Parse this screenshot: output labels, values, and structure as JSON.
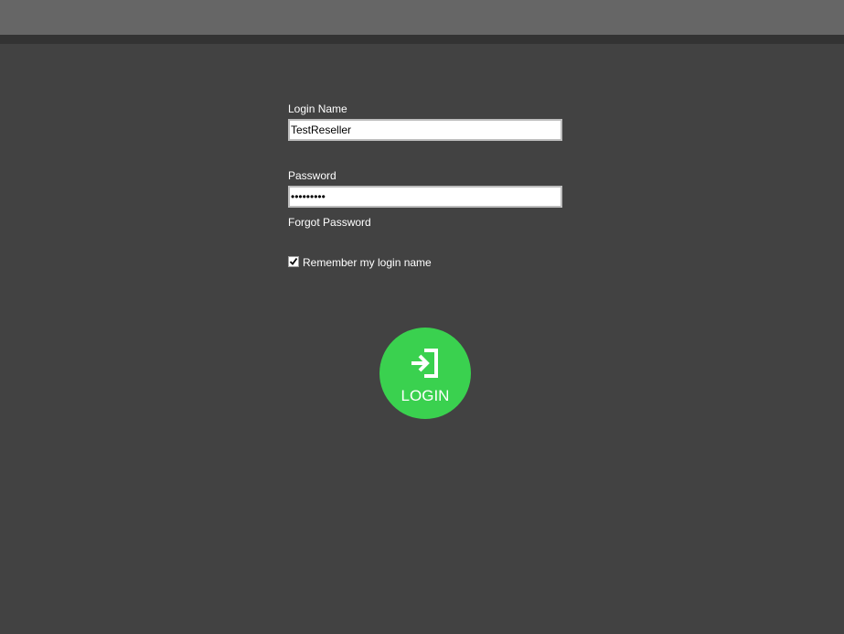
{
  "form": {
    "login_name_label": "Login Name",
    "login_name_value": "TestReseller",
    "password_label": "Password",
    "password_value": "•••••••••",
    "forgot_password": "Forgot Password",
    "remember_label": "Remember my login name",
    "remember_checked": true
  },
  "login_button": {
    "label": "LOGIN",
    "icon": "sign-in-icon",
    "color": "#3ad14f"
  },
  "colors": {
    "background": "#424242",
    "top_bar": "#666666",
    "sub_bar": "#333333"
  }
}
